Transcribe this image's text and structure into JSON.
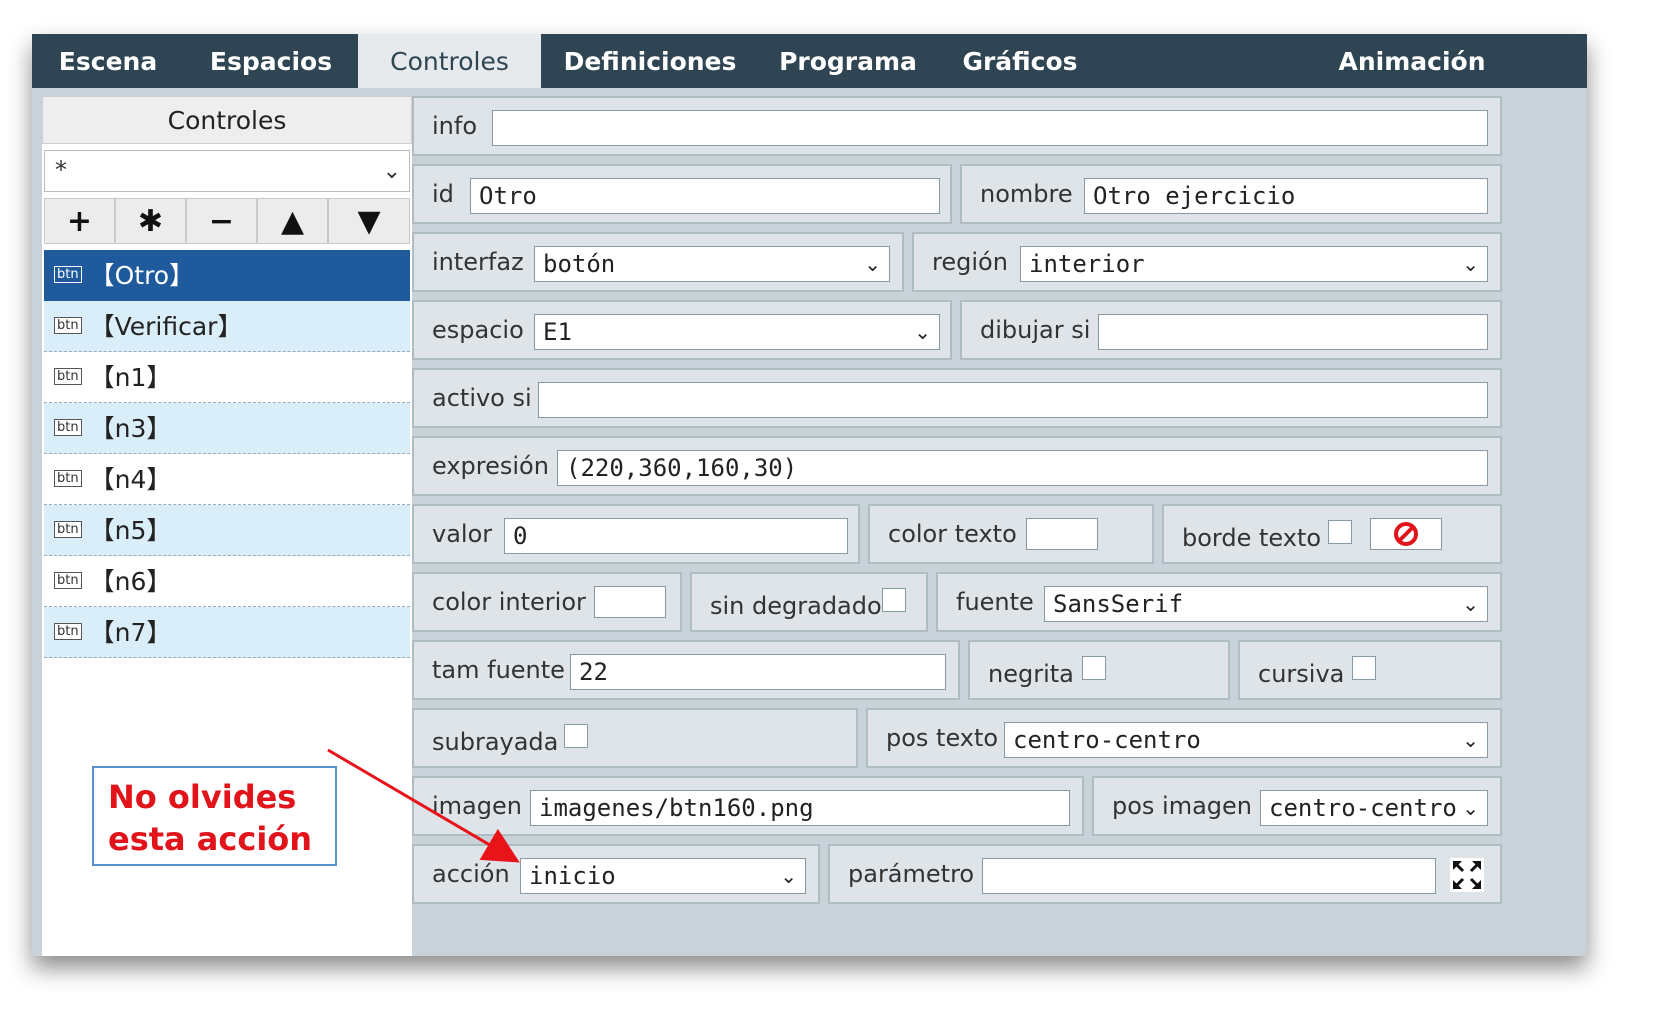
{
  "tabs": [
    "Escena",
    "Espacios",
    "Controles",
    "Definiciones",
    "Programa",
    "Gráficos",
    "Animación"
  ],
  "left": {
    "header": "Controles",
    "filter": "*",
    "tools": [
      "+",
      "✱",
      "−",
      "▲",
      "▼"
    ],
    "items": [
      {
        "badge": "btn",
        "label": "【Otro】"
      },
      {
        "badge": "btn",
        "label": "【Verificar】"
      },
      {
        "badge": "btn",
        "label": "【n1】"
      },
      {
        "badge": "btn",
        "label": "【n3】"
      },
      {
        "badge": "btn",
        "label": "【n4】"
      },
      {
        "badge": "btn",
        "label": "【n5】"
      },
      {
        "badge": "btn",
        "label": "【n6】"
      },
      {
        "badge": "btn",
        "label": "【n7】"
      }
    ]
  },
  "note": {
    "line1": "No olvides",
    "line2": "esta acción"
  },
  "form": {
    "info": {
      "label": "info",
      "value": ""
    },
    "id": {
      "label": "id",
      "value": "Otro"
    },
    "nombre": {
      "label": "nombre",
      "value": "Otro ejercicio"
    },
    "interfaz": {
      "label": "interfaz",
      "value": "botón"
    },
    "region": {
      "label": "región",
      "value": "interior"
    },
    "espacio": {
      "label": "espacio",
      "value": "E1"
    },
    "dibujar_si": {
      "label": "dibujar si",
      "value": ""
    },
    "activo_si": {
      "label": "activo si",
      "value": ""
    },
    "expresion": {
      "label": "expresión",
      "value": "(220,360,160,30)"
    },
    "valor": {
      "label": "valor",
      "value": "0"
    },
    "color_texto": {
      "label": "color texto"
    },
    "borde_texto": {
      "label": "borde texto"
    },
    "color_interior": {
      "label": "color interior"
    },
    "sin_degradado": {
      "label": "sin degradado"
    },
    "fuente": {
      "label": "fuente",
      "value": "SansSerif"
    },
    "tam_fuente": {
      "label": "tam fuente",
      "value": "22"
    },
    "negrita": {
      "label": "negrita"
    },
    "cursiva": {
      "label": "cursiva"
    },
    "subrayada": {
      "label": "subrayada"
    },
    "pos_texto": {
      "label": "pos texto",
      "value": "centro-centro"
    },
    "imagen": {
      "label": "imagen",
      "value": "imagenes/btn160.png"
    },
    "pos_imagen": {
      "label": "pos imagen",
      "value": "centro-centro"
    },
    "accion": {
      "label": "acción",
      "value": "inicio"
    },
    "parametro": {
      "label": "parámetro",
      "value": ""
    }
  },
  "colors": {
    "tabbar": "#2f4553",
    "selected": "#1e5a9c",
    "alt_row": "#d9eef9",
    "note_text": "#e0141a",
    "arrow": "#e8141a"
  },
  "icons": {
    "chevron": "chevron-down-icon",
    "no_border": "no-symbol-icon",
    "expand": "expand-icon"
  }
}
